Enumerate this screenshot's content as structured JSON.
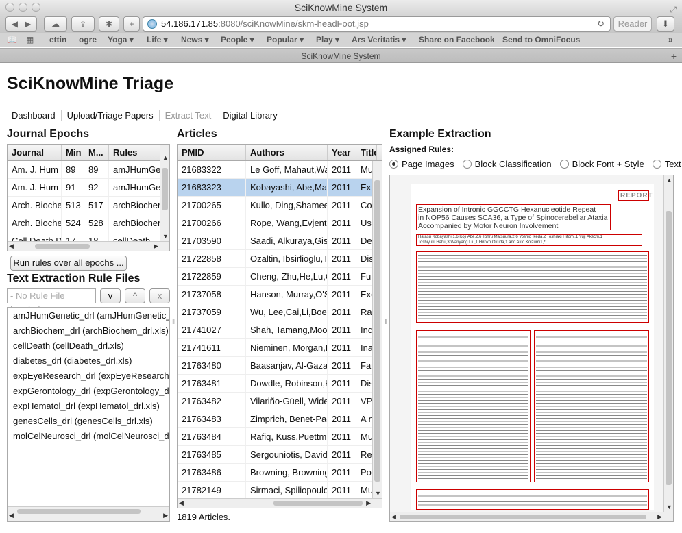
{
  "window": {
    "title": "SciKnowMine System"
  },
  "browser": {
    "url_host": "54.186.171.85",
    "url_path": ":8080/sciKnowMine/skm-headFoot.jsp",
    "reader_label": "Reader",
    "tab_title": "SciKnowMine System",
    "bookmarks": [
      "ettin",
      "ogre",
      "Yoga ▾",
      "Life ▾",
      "News ▾",
      "People ▾",
      "Popular ▾",
      "Play ▾",
      "Ars Veritatis ▾",
      "Share on Facebook",
      "Send to OmniFocus"
    ]
  },
  "app": {
    "title": "SciKnowMine Triage",
    "nav": [
      "Dashboard",
      "Upload/Triage Papers",
      "Extract Text",
      "Digital Library"
    ]
  },
  "epochs": {
    "heading": "Journal Epochs",
    "columns": [
      "Journal",
      "Min",
      "M...",
      "Rules"
    ],
    "rows": [
      [
        "Am. J. Hum",
        "89",
        "89",
        "amJHumGen"
      ],
      [
        "Am. J. Hum",
        "91",
        "92",
        "amJHumGen"
      ],
      [
        "Arch. Bioche",
        "513",
        "517",
        "archBiochem"
      ],
      [
        "Arch. Bioche",
        "524",
        "528",
        "archBiochem"
      ],
      [
        "Cell Death D",
        "17",
        "18",
        "cellDeath"
      ]
    ],
    "run_button": "Run rules over all epochs ..."
  },
  "rulefiles": {
    "heading": "Text Extraction Rule Files",
    "placeholder": "- No Rule File Loaded -",
    "btn_down": "v",
    "btn_up": "^",
    "btn_x": "x",
    "items": [
      "amJHumGenetic_drl (amJHumGenetic_drl.xls)",
      "archBiochem_drl (archBiochem_drl.xls)",
      "cellDeath (cellDeath_drl.xls)",
      "diabetes_drl (diabetes_drl.xls)",
      "expEyeResearch_drl (expEyeResearch_drl.xls)",
      "expGerontology_drl (expGerontology_drl.xls)",
      "expHematol_drl (expHematol_drl.xls)",
      "genesCells_drl (genesCells_drl.xls)",
      "molCelNeurosci_drl (molCelNeurosci_drl.xls)"
    ]
  },
  "articles": {
    "heading": "Articles",
    "columns": [
      "PMID",
      "Authors",
      "Year",
      "Title"
    ],
    "rows": [
      [
        "21683322",
        "Le Goff, Mahaut,Wa",
        "2011",
        "Mu"
      ],
      [
        "21683323",
        "Kobayashi, Abe,Mat",
        "2011",
        "Exp"
      ],
      [
        "21700265",
        "Kullo, Ding,Shamee",
        "2011",
        "Cor"
      ],
      [
        "21700266",
        "Rope, Wang,Evjentl",
        "2011",
        "Usi"
      ],
      [
        "21703590",
        "Saadi, Alkuraya,Gis",
        "2011",
        "Det"
      ],
      [
        "21722858",
        "Ozaltin, Ibsirlioglu,T",
        "2011",
        "Dis"
      ],
      [
        "21722859",
        "Cheng, Zhu,He,Lu,C",
        "2011",
        "Fur"
      ],
      [
        "21737058",
        "Hanson, Murray,O'S",
        "2011",
        "Exo"
      ],
      [
        "21737059",
        "Wu, Lee,Cai,Li,Boel",
        "2011",
        "Rar"
      ],
      [
        "21741027",
        "Shah, Tamang,Moo",
        "2011",
        "Ind"
      ],
      [
        "21741611",
        "Nieminen, Morgan,F",
        "2011",
        "Ina"
      ],
      [
        "21763480",
        "Baasanjav, Al-Gaza",
        "2011",
        "Fau"
      ],
      [
        "21763481",
        "Dowdle, Robinson,K",
        "2011",
        "Dis"
      ],
      [
        "21763482",
        "Vilariño-Güell, Wide",
        "2011",
        "VP"
      ],
      [
        "21763483",
        "Zimprich, Benet-Pag",
        "2011",
        "A n"
      ],
      [
        "21763484",
        "Rafiq, Kuss,Puettm",
        "2011",
        "Mu"
      ],
      [
        "21763485",
        "Sergouniotis, Davids",
        "2011",
        "Rec"
      ],
      [
        "21763486",
        "Browning, Browning",
        "2011",
        "Pop"
      ],
      [
        "21782149",
        "Sirmaci, Spiliopoulo",
        "2011",
        "Mu"
      ]
    ],
    "count": "1819 Articles."
  },
  "extraction": {
    "heading": "Example Extraction",
    "assigned_label": "Assigned Rules:",
    "modes": [
      "Page Images",
      "Block Classification",
      "Block Font + Style",
      "Text"
    ],
    "paper": {
      "report_label": "REPORT",
      "title_line1": "Expansion of Intronic GGCCTG Hexanucleotide Repeat",
      "title_line2": "in NOP56 Causes SCA36, a Type of Spinocerebellar Ataxia",
      "title_line3": "Accompanied by Motor Neuron Involvement",
      "authors_line1": "Hatasu Kobayashi,1,6 Koji Abe,2,6 Tohru Matsuura,2,6 Yoshio Ikeda,2 Toshiaki Hitomi,1 Yuji Akechi,1",
      "authors_line2": "Toshiyuki Habu,3 Wanyang Liu,1 Hiroko Okuda,1 and Akio Koizumi1,*"
    }
  }
}
